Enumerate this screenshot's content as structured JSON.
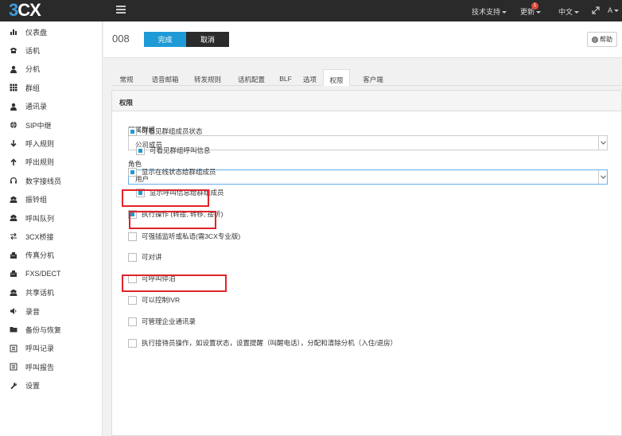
{
  "topbar": {
    "logo_three": "3",
    "logo_cx": "CX",
    "support": "技术支持",
    "updates": "更新",
    "updates_badge": "1",
    "language": "中文",
    "user": "A"
  },
  "sidebar": {
    "items": [
      {
        "label": "仪表盘",
        "icon": "bar-chart-icon"
      },
      {
        "label": "话机",
        "icon": "phone-icon"
      },
      {
        "label": "分机",
        "icon": "user-icon"
      },
      {
        "label": "群组",
        "icon": "grid-icon"
      },
      {
        "label": "通讯录",
        "icon": "user-icon"
      },
      {
        "label": "SIP中继",
        "icon": "globe-icon"
      },
      {
        "label": "呼入规则",
        "icon": "arrow-down-icon"
      },
      {
        "label": "呼出规则",
        "icon": "arrow-up-icon"
      },
      {
        "label": "数字接线员",
        "icon": "headset-icon"
      },
      {
        "label": "振铃组",
        "icon": "group-icon"
      },
      {
        "label": "呼叫队列",
        "icon": "group-icon"
      },
      {
        "label": "3CX桥接",
        "icon": "exchange-icon"
      },
      {
        "label": "传真分机",
        "icon": "fax-icon"
      },
      {
        "label": "FXS/DECT",
        "icon": "fax-icon"
      },
      {
        "label": "共享话机",
        "icon": "group-icon"
      },
      {
        "label": "录音",
        "icon": "speaker-icon"
      },
      {
        "label": "备份与恢复",
        "icon": "folder-icon"
      },
      {
        "label": "呼叫记录",
        "icon": "list-icon"
      },
      {
        "label": "呼叫报告",
        "icon": "list-icon"
      },
      {
        "label": "设置",
        "icon": "wrench-icon"
      }
    ]
  },
  "header": {
    "extension": "008",
    "done_label": "完成",
    "cancel_label": "取消",
    "help_label": "帮助"
  },
  "tabs": [
    {
      "label": "常规"
    },
    {
      "label": "语音邮箱"
    },
    {
      "label": "转发规则"
    },
    {
      "label": "话机配置"
    },
    {
      "label": "BLF"
    },
    {
      "label": "选项"
    },
    {
      "label": "权限",
      "active": true
    },
    {
      "label": "客户端"
    }
  ],
  "panel": {
    "title": "权限",
    "group_label": "所属群组",
    "group_value": "公司成员",
    "role_label": "角色",
    "role_value": "用户",
    "permissions": [
      {
        "label": "可看见群组成员状态",
        "checked": true
      },
      {
        "label": "可看见群组呼叫信息",
        "checked": true
      },
      {
        "label": "显示在线状态给群组成员",
        "checked": true
      },
      {
        "label": "显示呼叫信息给群组成员",
        "checked": true
      },
      {
        "label": "执行操作 (转接, 转移, 接听)",
        "checked": true
      },
      {
        "label": "可强插监听或私语(需3CX专业版)",
        "checked": false
      },
      {
        "label": "可对讲",
        "checked": false
      },
      {
        "label": "可呼叫停泊",
        "checked": false
      },
      {
        "label": "可以控制IVR",
        "checked": false
      },
      {
        "label": "可管理企业通讯录",
        "checked": false
      },
      {
        "label": "执行接待员操作，如设置状态，设置提醒（叫醒电话），分配和清除分机（入住/退房）",
        "checked": false
      }
    ]
  },
  "colors": {
    "topbar": "#2a2a2a",
    "accent": "#1e9ad6",
    "highlight": "#e0242a"
  }
}
